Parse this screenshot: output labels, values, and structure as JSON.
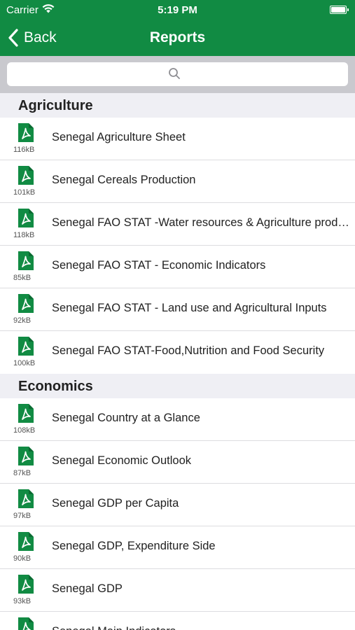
{
  "status_bar": {
    "carrier": "Carrier",
    "time": "5:19 PM"
  },
  "nav": {
    "back_label": "Back",
    "title": "Reports"
  },
  "search": {
    "placeholder": "",
    "icon": "search-icon"
  },
  "colors": {
    "brand": "#118b43",
    "pdf_icon": "#118b43",
    "section_bg": "#efeff4"
  },
  "sections": [
    {
      "title": "Agriculture",
      "items": [
        {
          "title": "Senegal Agriculture Sheet",
          "size": "116kB"
        },
        {
          "title": "Senegal Cereals Production",
          "size": "101kB"
        },
        {
          "title": "Senegal FAO  STAT -Water resources & Agriculture production",
          "size": "118kB"
        },
        {
          "title": "Senegal FAO STAT - Economic Indicators",
          "size": "85kB"
        },
        {
          "title": "Senegal FAO STAT - Land use and Agricultural Inputs",
          "size": "92kB"
        },
        {
          "title": "Senegal FAO STAT-Food,Nutrition and Food Security",
          "size": "100kB"
        }
      ]
    },
    {
      "title": "Economics",
      "items": [
        {
          "title": "Senegal Country at a Glance",
          "size": "108kB"
        },
        {
          "title": "Senegal Economic Outlook",
          "size": "87kB"
        },
        {
          "title": "Senegal GDP per Capita",
          "size": "97kB"
        },
        {
          "title": "Senegal GDP, Expenditure Side",
          "size": "90kB"
        },
        {
          "title": "Senegal GDP",
          "size": "93kB"
        },
        {
          "title": "Senegal Main Indicators",
          "size": ""
        }
      ]
    }
  ]
}
